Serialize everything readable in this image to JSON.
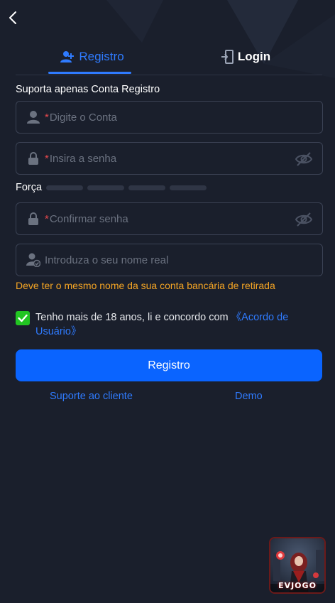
{
  "tabs": [
    {
      "label": "Registro",
      "icon": "add-user-icon",
      "active": true
    },
    {
      "label": "Login",
      "icon": "login-door-icon",
      "active": false
    }
  ],
  "form": {
    "title": "Suporta apenas Conta Registro",
    "required_mark": "*",
    "account_placeholder": "Digite o Conta",
    "password_placeholder": "Insira a senha",
    "strength_label": "Força",
    "confirm_placeholder": "Confirmar senha",
    "realname_placeholder": "Introduza o seu nome real",
    "realname_warning": "Deve ter o mesmo nome da sua conta bancária de retirada",
    "agree_text": "Tenho mais de 18 anos, li e concordo com ",
    "agree_link": "《Acordo de Usuário》",
    "agree_checked": true,
    "submit_label": "Registro"
  },
  "footer": {
    "support_label": "Suporte ao cliente",
    "demo_label": "Demo"
  },
  "promo": {
    "label": "EVJOGO"
  },
  "colors": {
    "background": "#1a1f2c",
    "accent": "#2f7bff",
    "button": "#0a64ff",
    "warning": "#f5a524",
    "required": "#e5484d",
    "checkbox": "#22c522"
  }
}
